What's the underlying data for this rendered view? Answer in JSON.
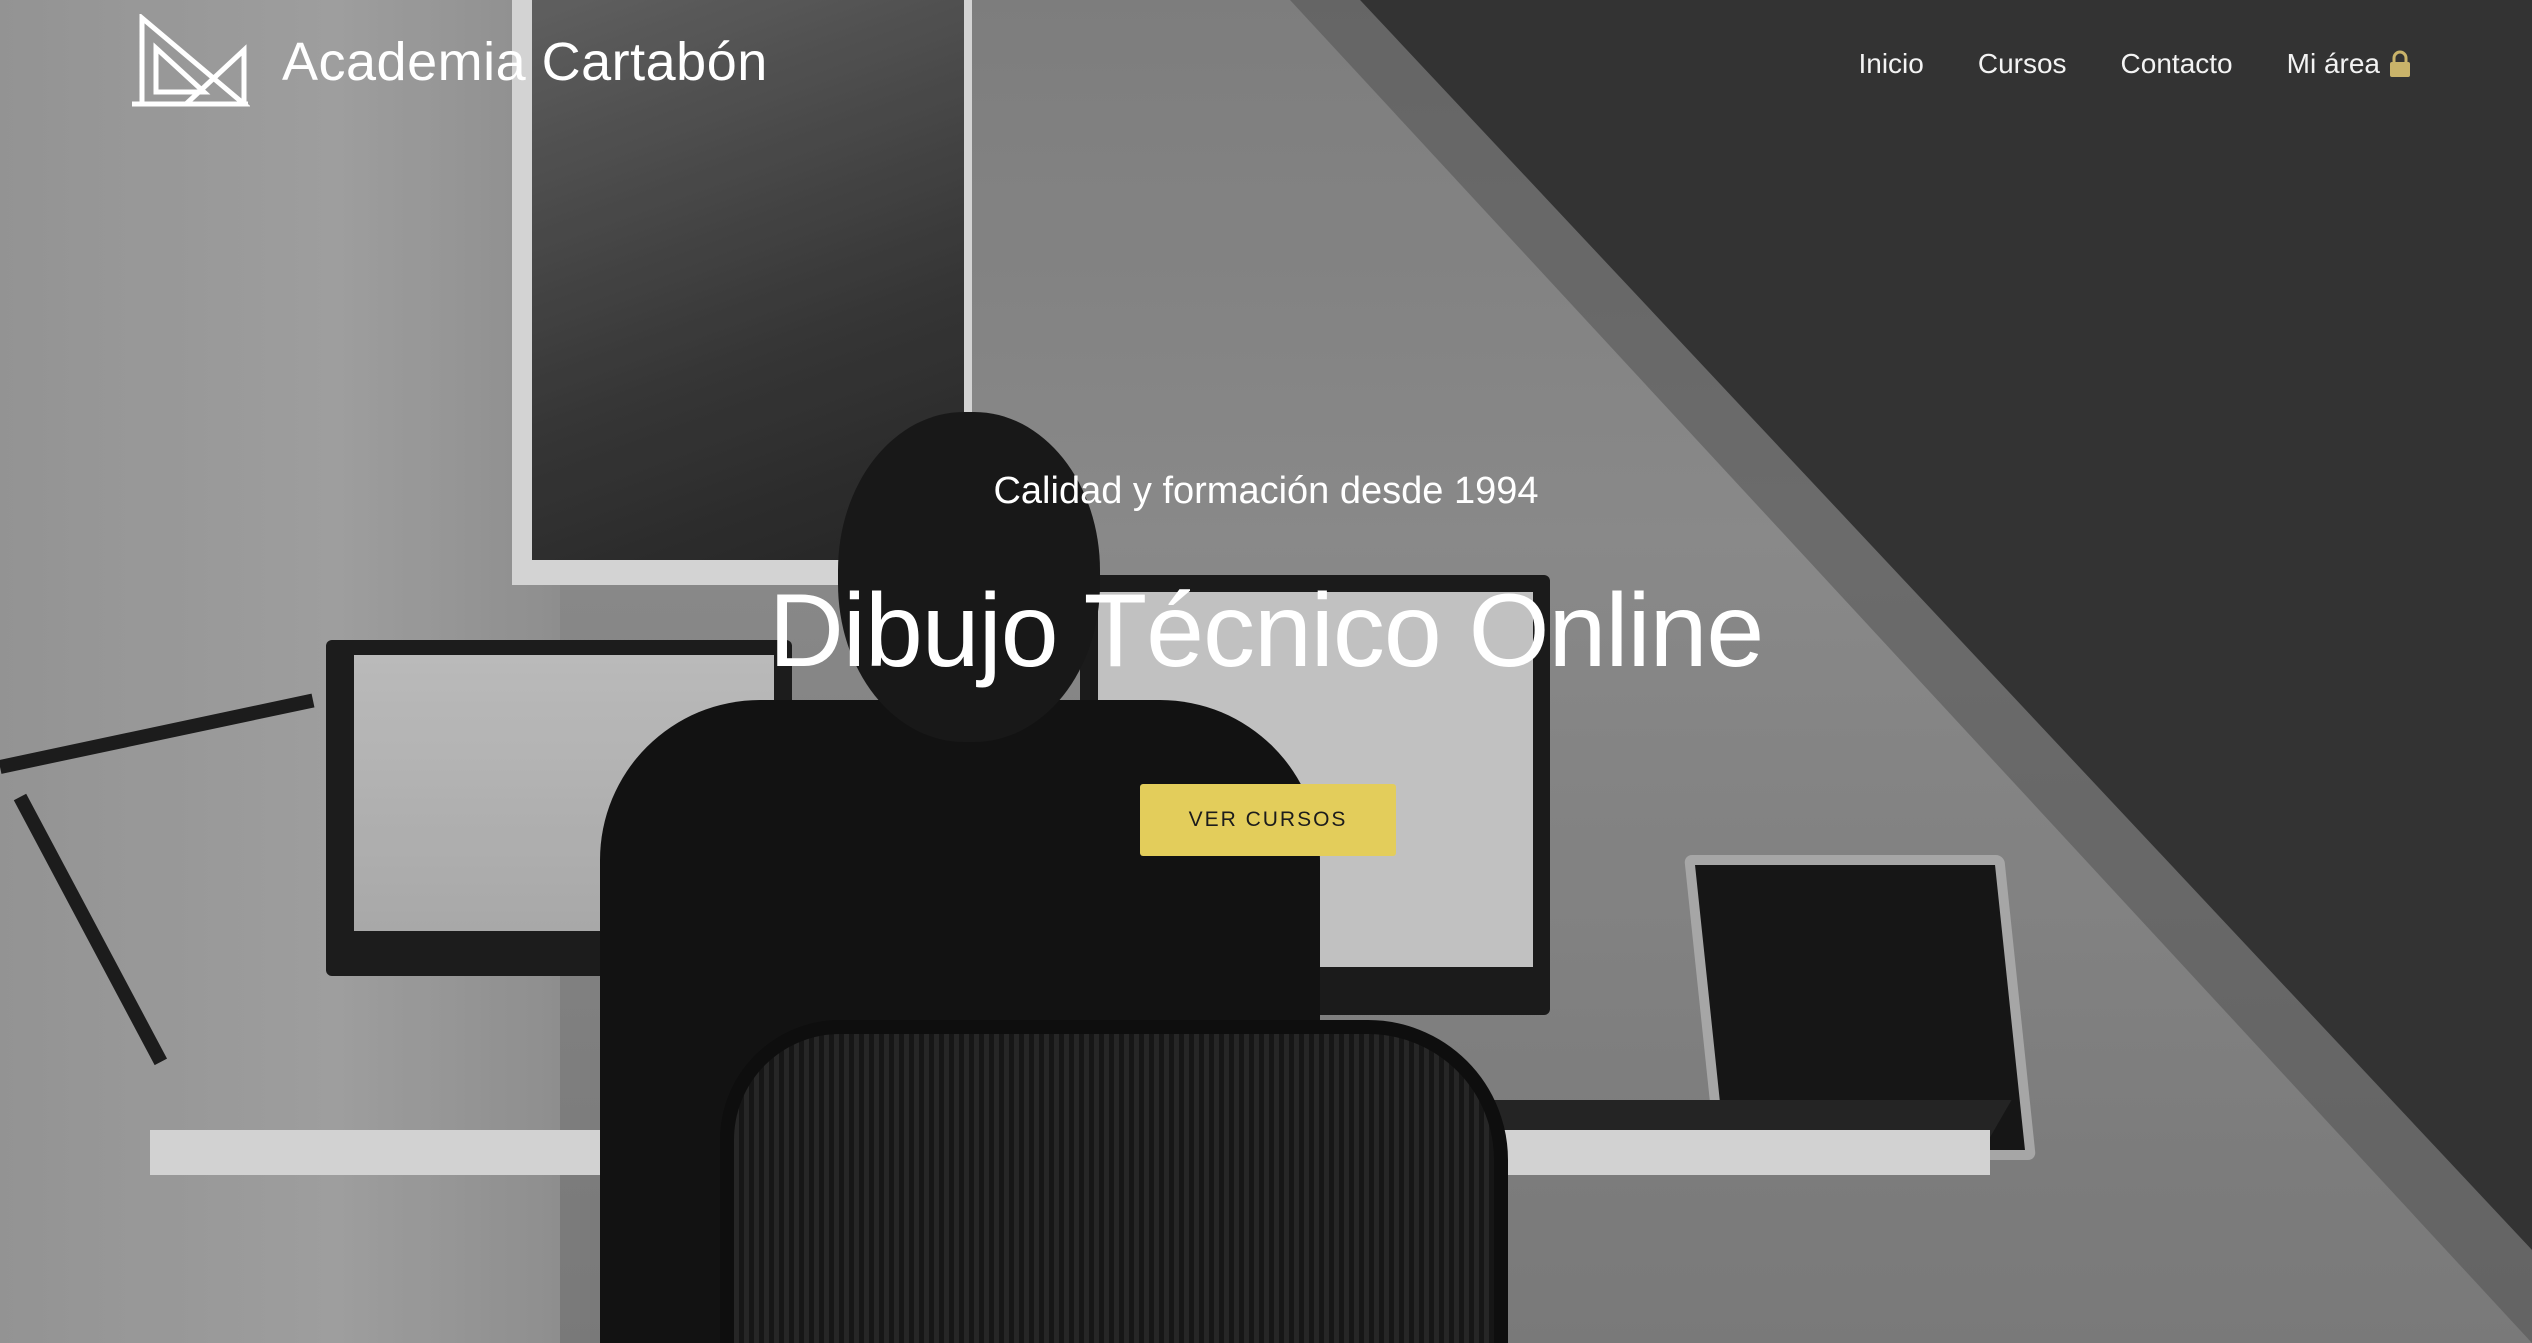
{
  "header": {
    "logo_text": "Academia Cartabón",
    "logo_icon": "set-square-logo-icon"
  },
  "nav": {
    "items": [
      {
        "label": "Inicio"
      },
      {
        "label": "Cursos"
      },
      {
        "label": "Contacto"
      },
      {
        "label": "Mi área",
        "icon": "lock-icon"
      }
    ]
  },
  "hero": {
    "subtitle": "Calidad y formación desde 1994",
    "title": "Dibujo Técnico Online",
    "cta_label": "VER CURSOS",
    "background": "grayscale photo of person working at desk with monitors"
  },
  "colors": {
    "accent": "#e3cd5b",
    "lock_icon": "#c9b36a",
    "text": "#ffffff",
    "dark_panel": "#3b3b3b"
  }
}
